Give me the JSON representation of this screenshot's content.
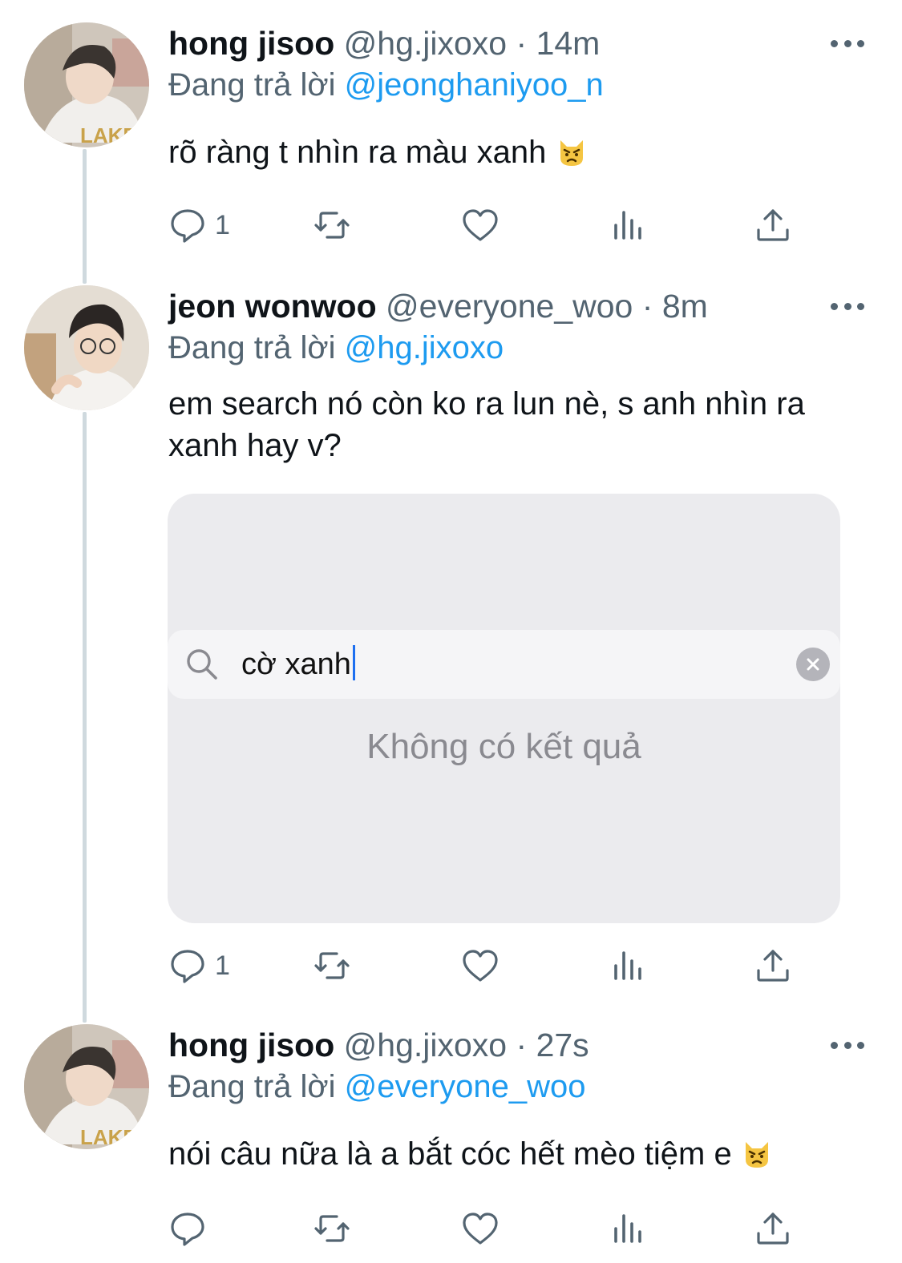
{
  "tweets": [
    {
      "name": "hong jisoo",
      "handle": "@hg.jixoxo",
      "time": "14m",
      "replying_prefix": "Đang trả lời",
      "replying_to": "@jeonghaniyoo_n",
      "text": "rõ ràng t nhìn ra màu xanh",
      "emoji": "pouting-cat-emoji",
      "reply_count": "1"
    },
    {
      "name": "jeon wonwoo",
      "handle": "@everyone_woo",
      "time": "8m",
      "replying_prefix": "Đang trả lời",
      "replying_to": "@hg.jixoxo",
      "text_line1": "em search nó còn ko ra lun nè, s anh nhìn ra",
      "text_line2": "xanh hay v?",
      "reply_count": "1",
      "media": {
        "search_query": "cờ xanh",
        "no_results": "Không có kết quả"
      }
    },
    {
      "name": "hong jisoo",
      "handle": "@hg.jixoxo",
      "time": "27s",
      "replying_prefix": "Đang trả lời",
      "replying_to": "@everyone_woo",
      "text": "nói câu nữa là a bắt cóc hết mèo tiệm e",
      "emoji": "pouting-cat-emoji",
      "reply_count": ""
    }
  ],
  "separator": "·",
  "colors": {
    "link": "#1d9bf0",
    "secondary_text": "#536471",
    "thread_line": "#cfd9de"
  }
}
